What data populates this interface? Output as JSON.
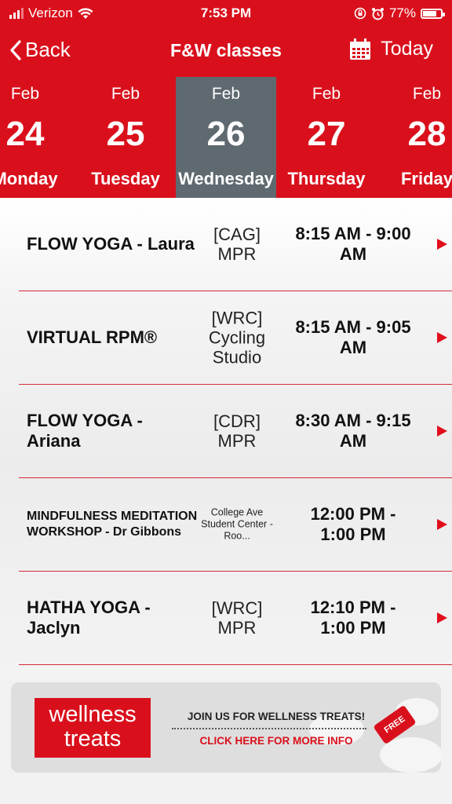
{
  "status_bar": {
    "carrier": "Verizon",
    "time": "7:53 PM",
    "battery": "77%",
    "battery_level": 0.77
  },
  "nav": {
    "back_label": "Back",
    "title": "F&W classes",
    "today_label": "Today"
  },
  "days": [
    {
      "month": "Feb",
      "day": "24",
      "weekday": "Monday",
      "selected": false
    },
    {
      "month": "Feb",
      "day": "25",
      "weekday": "Tuesday",
      "selected": false
    },
    {
      "month": "Feb",
      "day": "26",
      "weekday": "Wednesday",
      "selected": true
    },
    {
      "month": "Feb",
      "day": "27",
      "weekday": "Thursday",
      "selected": false
    },
    {
      "month": "Feb",
      "day": "28",
      "weekday": "Friday",
      "selected": false
    }
  ],
  "classes": [
    {
      "name": "FLOW YOGA - Laura",
      "location": "[CAG] MPR",
      "time": "8:15 AM - 9:00 AM"
    },
    {
      "name": "VIRTUAL RPM®",
      "location": "[WRC] Cycling Studio",
      "time": "8:15 AM - 9:05 AM"
    },
    {
      "name": "FLOW YOGA - Ariana",
      "location": "[CDR] MPR",
      "time": "8:30 AM - 9:15 AM"
    },
    {
      "name": "MINDFULNESS MEDITATION WORKSHOP - Dr Gibbons",
      "location": "College Ave Student Center - Roo...",
      "time": "12:00 PM - 1:00 PM"
    },
    {
      "name": "HATHA YOGA - Jaclyn",
      "location": "[WRC] MPR",
      "time": "12:10 PM - 1:00 PM"
    }
  ],
  "banner": {
    "logo_line1": "wellness",
    "logo_line2": "treats",
    "headline": "JOIN US FOR WELLNESS TREATS!",
    "cta": "CLICK HERE FOR MORE INFO",
    "tag": "FREE"
  },
  "colors": {
    "brand_red": "#d9101c",
    "selected_day": "#5f6a70"
  }
}
